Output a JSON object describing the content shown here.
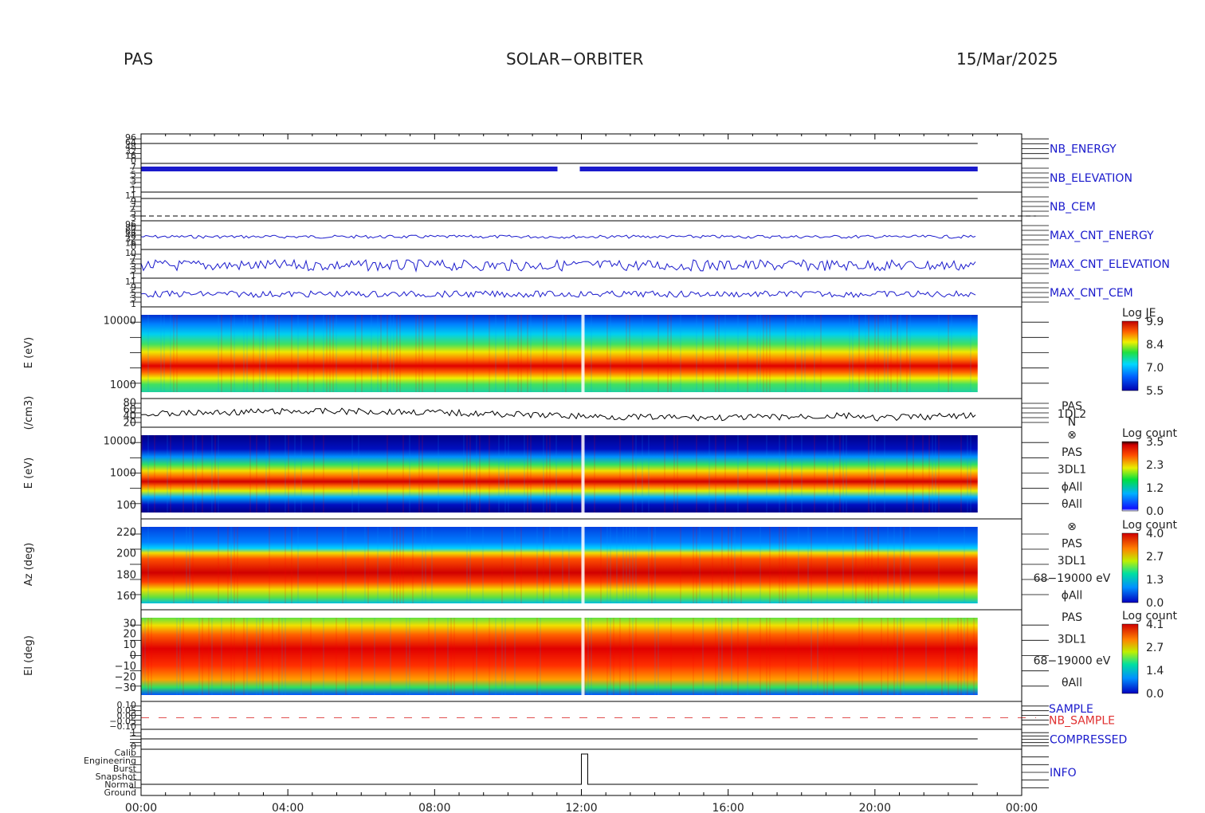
{
  "header": {
    "instrument": "PAS",
    "mission": "SOLAR−ORBITER",
    "date": "15/Mar/2025"
  },
  "colors": {
    "blue_line": "#1a1acc",
    "red_line": "#e05050",
    "axis": "#000000"
  },
  "chart_data": {
    "type": "heatmap",
    "x_ticks": [
      "00:00",
      "04:00",
      "08:00",
      "12:00",
      "16:00",
      "20:00",
      "00:00"
    ],
    "x_range_hours": [
      0,
      24
    ],
    "data_end_hour": 22.8,
    "panels": [
      {
        "id": "nb_energy",
        "type": "line",
        "right_label": "NB_ENERGY",
        "ticks": [
          "96",
          "64",
          "48",
          "32",
          "16",
          "0"
        ]
      },
      {
        "id": "nb_elevation",
        "type": "line",
        "right_label": "NB_ELEVATION",
        "ticks": [
          "7",
          "5",
          "3",
          "1"
        ]
      },
      {
        "id": "nb_cem",
        "type": "line",
        "right_label": "NB_CEM",
        "ticks": [
          "11",
          "9",
          "7",
          "5",
          "3"
        ]
      },
      {
        "id": "max_cnt_energy",
        "type": "line",
        "right_label": "MAX_CNT_ENERGY",
        "ticks": [
          "96",
          "80",
          "64",
          "48",
          "32",
          "16",
          "0"
        ]
      },
      {
        "id": "max_cnt_elevation",
        "type": "line",
        "right_label": "MAX_CNT_ELEVATION",
        "ticks": [
          "10",
          "7",
          "5",
          "3",
          "1"
        ]
      },
      {
        "id": "max_cnt_cem",
        "type": "line",
        "right_label": "MAX_CNT_CEM",
        "ticks": [
          "11",
          "9",
          "5",
          "3",
          "1"
        ]
      },
      {
        "id": "energy_je",
        "type": "heatmap",
        "ylabel": "E (eV)",
        "y_scale": "log",
        "y_ticks": [
          "10000",
          "1000"
        ],
        "colorbar": {
          "title": "Log JE",
          "ticks": [
            "9.9",
            "8.4",
            "7.0",
            "5.5"
          ]
        }
      },
      {
        "id": "density",
        "type": "line",
        "ylabel": "(/cm3)",
        "y_ticks": [
          "80",
          "60",
          "40",
          "20"
        ],
        "right_labels": [
          "PAS",
          "1DL2",
          "N"
        ]
      },
      {
        "id": "energy_count",
        "type": "heatmap",
        "ylabel": "E (eV)",
        "y_scale": "log",
        "y_ticks": [
          "10000",
          "1000",
          "100"
        ],
        "colorbar": {
          "title": "Log count",
          "ticks": [
            "3.5",
            "2.3",
            "1.2",
            "0.0"
          ]
        },
        "right_labels": [
          "⊗",
          "PAS",
          "3DL1",
          "ϕAll",
          "θAll"
        ]
      },
      {
        "id": "azimuth",
        "type": "heatmap",
        "ylabel": "Az (deg)",
        "y_ticks": [
          "220",
          "200",
          "180",
          "160"
        ],
        "colorbar": {
          "title": "Log count",
          "ticks": [
            "4.0",
            "2.7",
            "1.3",
            "0.0"
          ]
        },
        "right_labels": [
          "⊗",
          "PAS",
          "3DL1",
          "68−19000 eV",
          "ϕAll"
        ]
      },
      {
        "id": "elevation",
        "type": "heatmap",
        "ylabel": "El (deg)",
        "y_ticks": [
          "30",
          "20",
          "10",
          "0",
          "−10",
          "−20",
          "−30"
        ],
        "colorbar": {
          "title": "Log count",
          "ticks": [
            "4.1",
            "2.7",
            "1.4",
            "0.0"
          ]
        },
        "right_labels": [
          "PAS",
          "3DL1",
          "68−19000 eV",
          "θAll"
        ]
      },
      {
        "id": "sample",
        "type": "line",
        "right_labels": [
          "SAMPLE",
          "NB_SAMPLE"
        ],
        "ticks": [
          "0.10",
          "0.05",
          "0.00",
          "−0.05",
          "−0.10"
        ]
      },
      {
        "id": "compressed",
        "type": "line",
        "right_label": "COMPRESSED",
        "ticks": [
          "1",
          "0"
        ]
      },
      {
        "id": "info",
        "type": "line",
        "right_label": "INFO",
        "ticks": [
          "Calib",
          "Engineering",
          "Burst",
          "Snapshot",
          "Normal",
          "Ground"
        ]
      }
    ]
  }
}
